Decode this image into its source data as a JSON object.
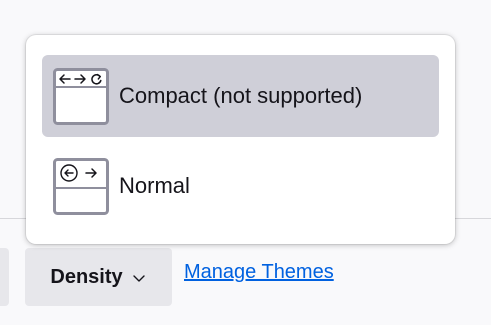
{
  "density_menu": {
    "items": [
      {
        "label": "Compact (not supported)",
        "icon": "compact-density-icon",
        "selected": true
      },
      {
        "label": "Normal",
        "icon": "normal-density-icon",
        "selected": false
      }
    ]
  },
  "toolbar": {
    "density_label": "Density",
    "density_chevron_icon": "chevron-down-icon",
    "manage_themes_label": "Manage Themes"
  },
  "colors": {
    "selected_item": "#cfcfd8",
    "link": "#0061e0",
    "button_bg": "#e7e7eb",
    "text": "#15141a"
  }
}
